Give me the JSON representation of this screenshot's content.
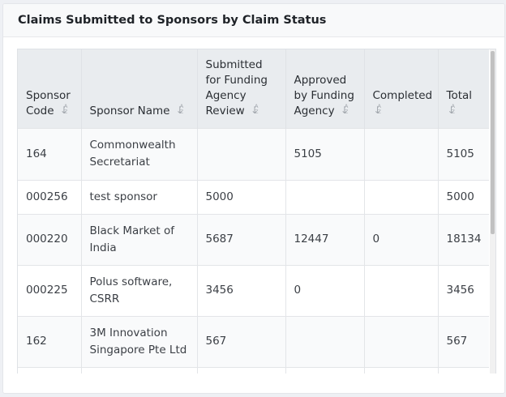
{
  "card": {
    "title": "Claims Submitted to Sponsors by Claim Status"
  },
  "table": {
    "columns": [
      {
        "label": "Sponsor Code"
      },
      {
        "label": "Sponsor Name"
      },
      {
        "label": "Submitted for Funding Agency Review"
      },
      {
        "label": "Approved by Funding Agency"
      },
      {
        "label": "Completed"
      },
      {
        "label": "Total"
      }
    ],
    "rows": [
      {
        "code": "164",
        "name": "Commonwealth Secretariat",
        "submitted": "",
        "approved": "5105",
        "completed": "",
        "total": "5105"
      },
      {
        "code": "000256",
        "name": "test sponsor",
        "submitted": "5000",
        "approved": "",
        "completed": "",
        "total": "5000"
      },
      {
        "code": "000220",
        "name": "Black Market of India",
        "submitted": "5687",
        "approved": "12447",
        "completed": "0",
        "total": "18134"
      },
      {
        "code": "000225",
        "name": "Polus software, CSRR",
        "submitted": "3456",
        "approved": "0",
        "completed": "",
        "total": "3456"
      },
      {
        "code": "162",
        "name": "3M Innovation Singapore Pte Ltd",
        "submitted": "567",
        "approved": "",
        "completed": "",
        "total": "567"
      },
      {
        "code": "",
        "name": "",
        "submitted": "",
        "approved": "",
        "completed": "",
        "total": ""
      }
    ]
  },
  "icons": {
    "sort": "sort-alpha-icon"
  }
}
